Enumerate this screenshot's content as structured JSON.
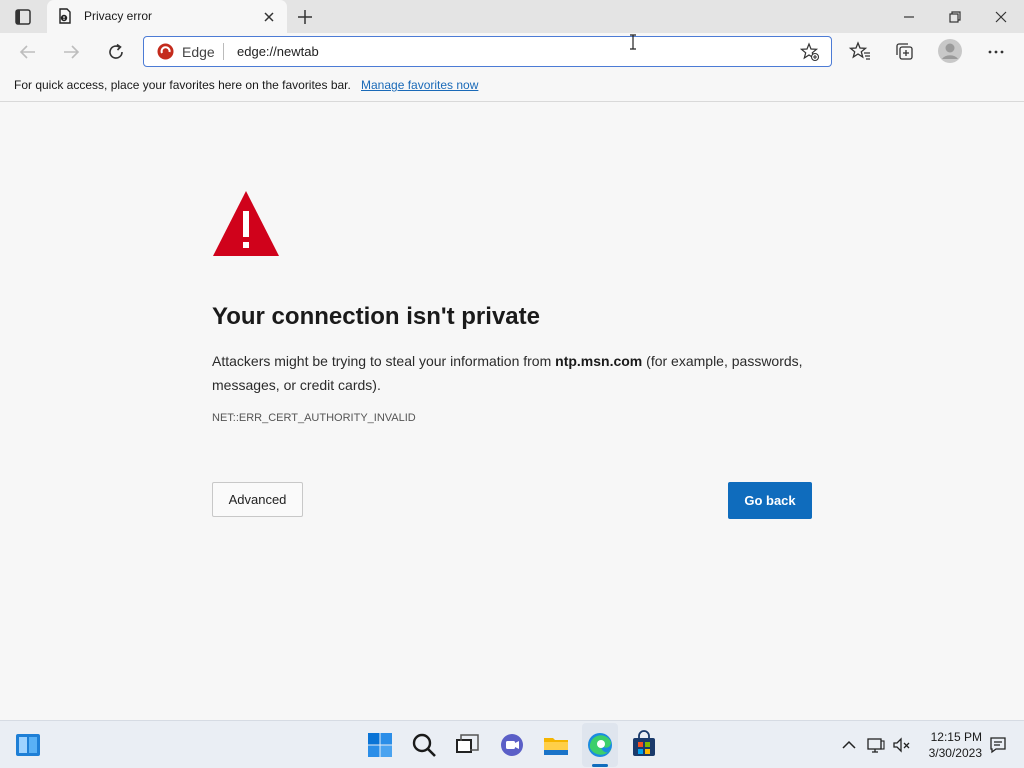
{
  "tab": {
    "title": "Privacy error"
  },
  "address_bar": {
    "site_name": "Edge",
    "url": "edge://newtab"
  },
  "favorites_bar": {
    "message": "For quick access, place your favorites here on the favorites bar.",
    "link": "Manage favorites now"
  },
  "error_page": {
    "heading": "Your connection isn't private",
    "desc_before": "Attackers might be trying to steal your information from ",
    "desc_host": "ntp.msn.com",
    "desc_after": " (for example, passwords, messages, or credit cards).",
    "error_code": "NET::ERR_CERT_AUTHORITY_INVALID",
    "advanced_label": "Advanced",
    "goback_label": "Go back"
  },
  "taskbar": {
    "time": "12:15 PM",
    "date": "3/30/2023"
  },
  "colors": {
    "accent": "#0f6cbd",
    "warning": "#d0021b",
    "link": "#1a6ab8"
  }
}
